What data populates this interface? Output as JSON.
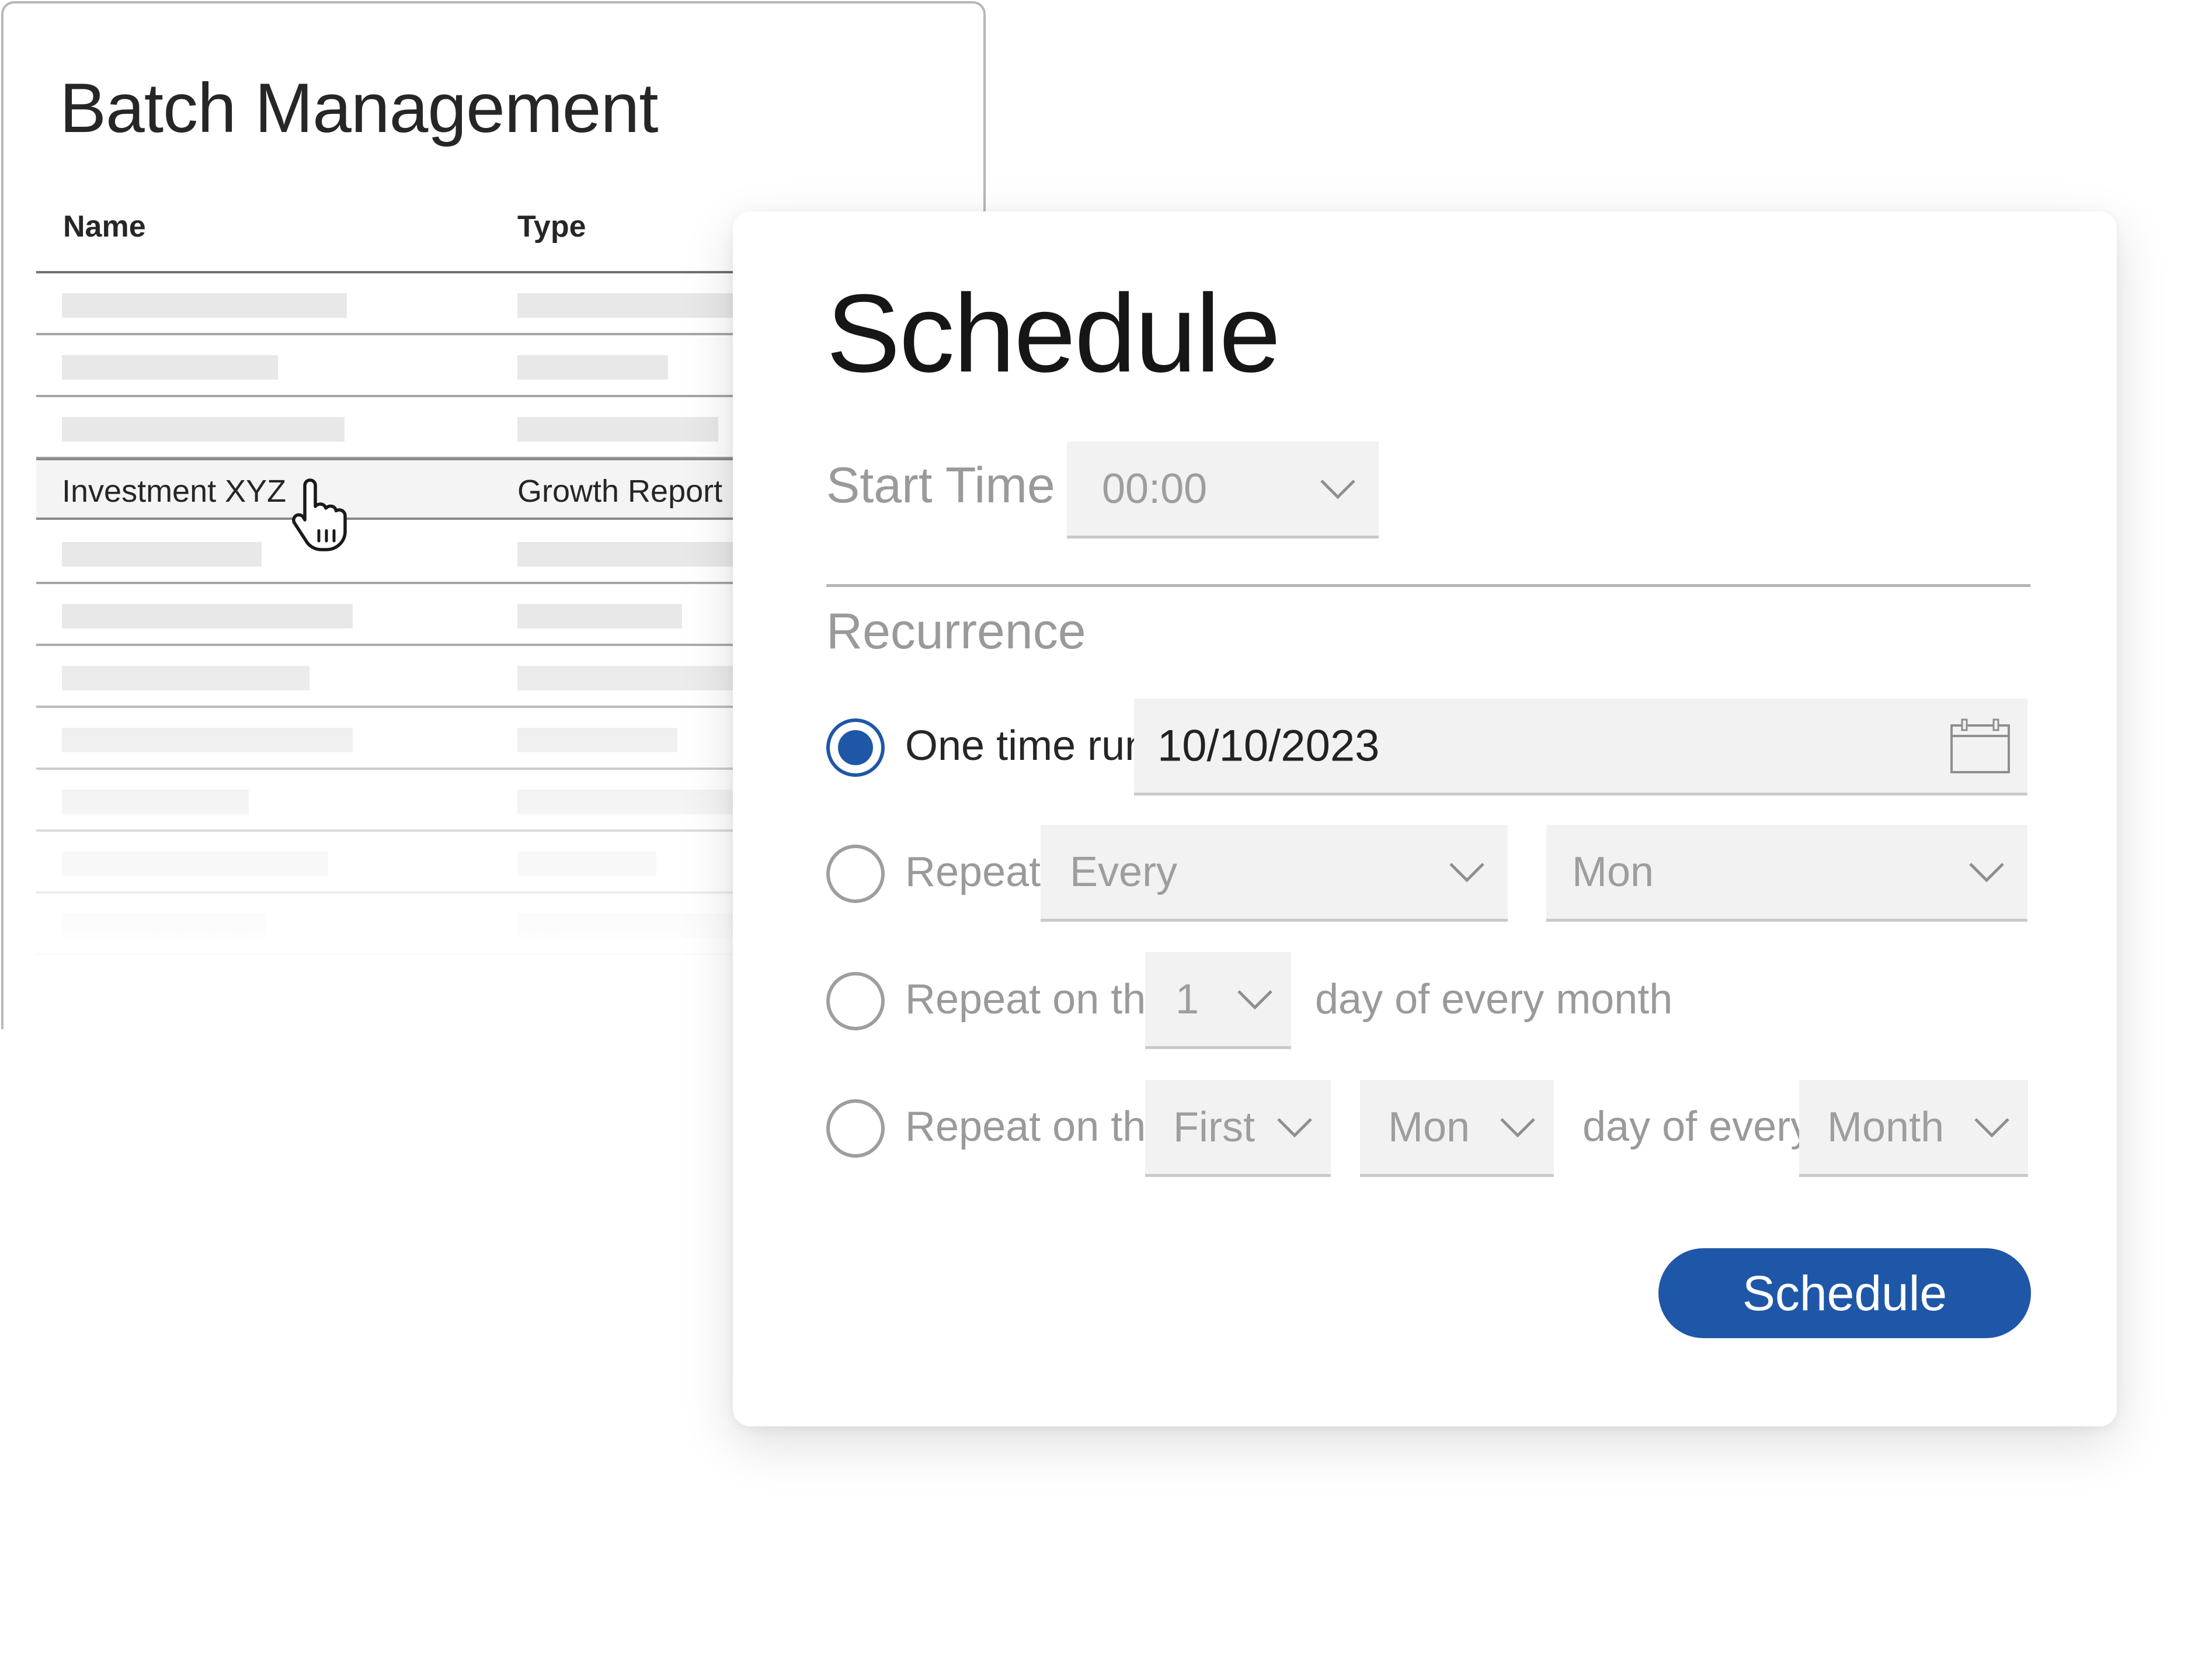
{
  "batch": {
    "title": "Batch Management",
    "columns": [
      "Name",
      "Type"
    ],
    "selected_row": {
      "name": "Investment XYZ",
      "type": "Growth Report"
    }
  },
  "schedule": {
    "title": "Schedule",
    "start_time": {
      "label": "Start Time",
      "value": "00:00"
    },
    "recurrence": {
      "label": "Recurrence",
      "one_time": {
        "label": "One time run",
        "date": "10/10/2023",
        "selected": true
      },
      "repeat": {
        "label": "Repeat",
        "interval": "Every",
        "day": "Mon"
      },
      "repeat_day_of_month": {
        "label": "Repeat on the",
        "day": "1",
        "suffix": "day of every month"
      },
      "repeat_weekday_of_month": {
        "label": "Repeat on the",
        "ordinal": "First",
        "weekday": "Mon",
        "middle": "day of every",
        "period": "Month"
      }
    },
    "submit_label": "Schedule"
  },
  "colors": {
    "accent": "#1f57a8",
    "muted_text": "#9a9a9a",
    "field_bg": "#f2f2f2"
  },
  "icons": [
    "pointer-hand-icon",
    "chevron-down-icon",
    "calendar-icon"
  ]
}
